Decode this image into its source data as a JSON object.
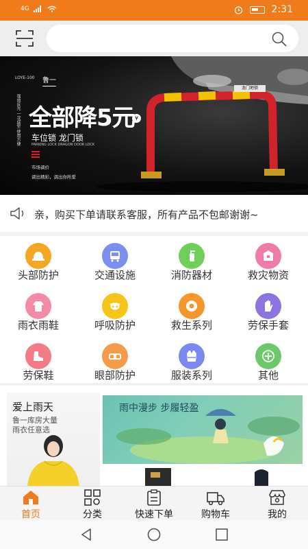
{
  "status_bar": {
    "signal": "4G",
    "time": "2:31"
  },
  "search": {
    "placeholder": ""
  },
  "banner": {
    "model": "LOYE-100",
    "brand": "鲁一",
    "vertical_text": "强效反光 一次成型 使用方便",
    "headline": "全部降5元",
    "currency_mark": "¥",
    "subtitle": "车位锁 龙门锁",
    "subtitle_en": "PARKING LOCK DRAGON DOOR LOCK",
    "market_line1": "市场调价",
    "market_line2": "调出精彩，调出你所爱",
    "plate_text": "龙门地锁"
  },
  "notice": {
    "text": "亲，购买下单请联系客服，所有产品不包邮谢谢~"
  },
  "categories": [
    {
      "label": "头部防护",
      "icon": "helmet-icon",
      "color": "#f5a623"
    },
    {
      "label": "交通设施",
      "icon": "bus-icon",
      "color": "#7b8ff0"
    },
    {
      "label": "消防器材",
      "icon": "extinguisher-icon",
      "color": "#6fcf5a"
    },
    {
      "label": "救灾物资",
      "icon": "box-icon",
      "color": "#f07aa8"
    },
    {
      "label": "雨衣雨鞋",
      "icon": "raincoat-icon",
      "color": "#f28aa8"
    },
    {
      "label": "呼吸防护",
      "icon": "mask-icon",
      "color": "#f5c518"
    },
    {
      "label": "救生系列",
      "icon": "lifebuoy-icon",
      "color": "#f5962a"
    },
    {
      "label": "劳保手套",
      "icon": "glove-icon",
      "color": "#8b73e0"
    },
    {
      "label": "劳保鞋",
      "icon": "shoe-icon",
      "color": "#f27c86"
    },
    {
      "label": "眼部防护",
      "icon": "goggles-icon",
      "color": "#f59c4a"
    },
    {
      "label": "服装系列",
      "icon": "vest-icon",
      "color": "#7b88f0"
    },
    {
      "label": "其他",
      "icon": "plus-icon",
      "color": "#6cc96a"
    }
  ],
  "promo": {
    "left_title": "爱上雨天",
    "left_line1": "鲁一库房大量",
    "left_line2": "雨衣任意选",
    "right_title": "雨中漫步 步履轻盈"
  },
  "tabs": [
    {
      "label": "首页",
      "icon": "home-icon",
      "active": true
    },
    {
      "label": "分类",
      "icon": "grid-icon",
      "active": false
    },
    {
      "label": "快速下单",
      "icon": "clipboard-icon",
      "active": false
    },
    {
      "label": "购物车",
      "icon": "truck-icon",
      "active": false
    },
    {
      "label": "我的",
      "icon": "store-icon",
      "active": false
    }
  ],
  "colors": {
    "accent": "#ef7b1b"
  }
}
